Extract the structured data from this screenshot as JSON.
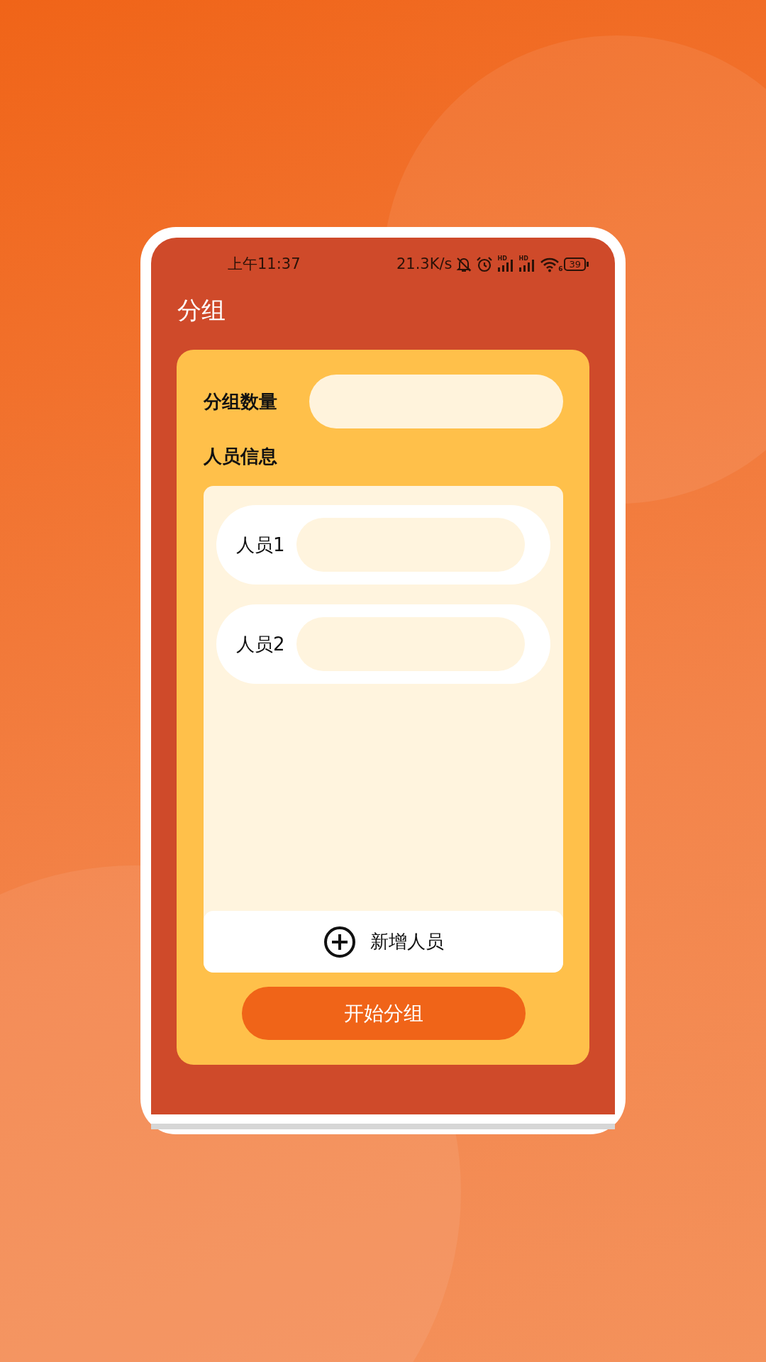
{
  "status_bar": {
    "time": "上午11:37",
    "network_speed": "21.3K/s",
    "signal_labels": [
      "HD",
      "HD"
    ],
    "wifi_label": "6",
    "battery": "39"
  },
  "app_bar": {
    "title": "分组"
  },
  "group_count": {
    "label": "分组数量"
  },
  "members": {
    "title": "人员信息",
    "items": [
      {
        "label": "人员1"
      },
      {
        "label": "人员2"
      }
    ]
  },
  "add_button": {
    "label": "新增人员"
  },
  "start_button": {
    "label": "开始分组"
  }
}
